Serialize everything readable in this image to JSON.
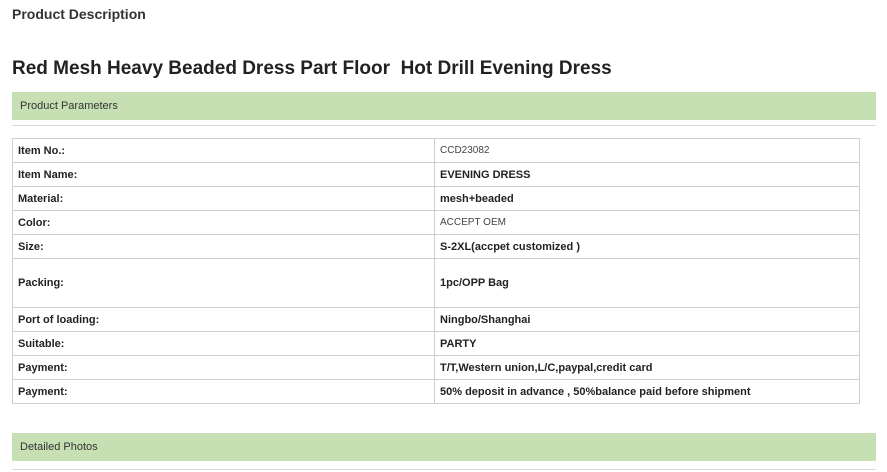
{
  "page": {
    "section_title": "Product Description",
    "product_title": "Red Mesh Heavy Beaded Dress Part Floor  Hot Drill Evening Dress"
  },
  "parameters_bar": {
    "label": "Product Parameters"
  },
  "parameters": [
    {
      "label": "Item No.:",
      "value": "CCD23082"
    },
    {
      "label": "Item Name:",
      "value": "EVENING DRESS"
    },
    {
      "label": "Material:",
      "value": "mesh+beaded"
    },
    {
      "label": "Color:",
      "value": "ACCEPT OEM"
    },
    {
      "label": "Size:",
      "value": "S-2XL(accpet customized )"
    },
    {
      "label": "Packing:",
      "value": "1pc/OPP Bag"
    },
    {
      "label": "Port of loading:",
      "value": "Ningbo/Shanghai"
    },
    {
      "label": "Suitable:",
      "value": "PARTY"
    },
    {
      "label": "Payment:",
      "value": "T/T,Western union,L/C,paypal,credit card"
    },
    {
      "label": "Payment:",
      "value": "50% deposit in advance , 50%balance paid before shipment"
    }
  ],
  "photos_bar": {
    "label": "Detailed Photos"
  },
  "colors": {
    "section_bar_bg": "#c6e0b4",
    "table_border": "#cfcfcf"
  }
}
